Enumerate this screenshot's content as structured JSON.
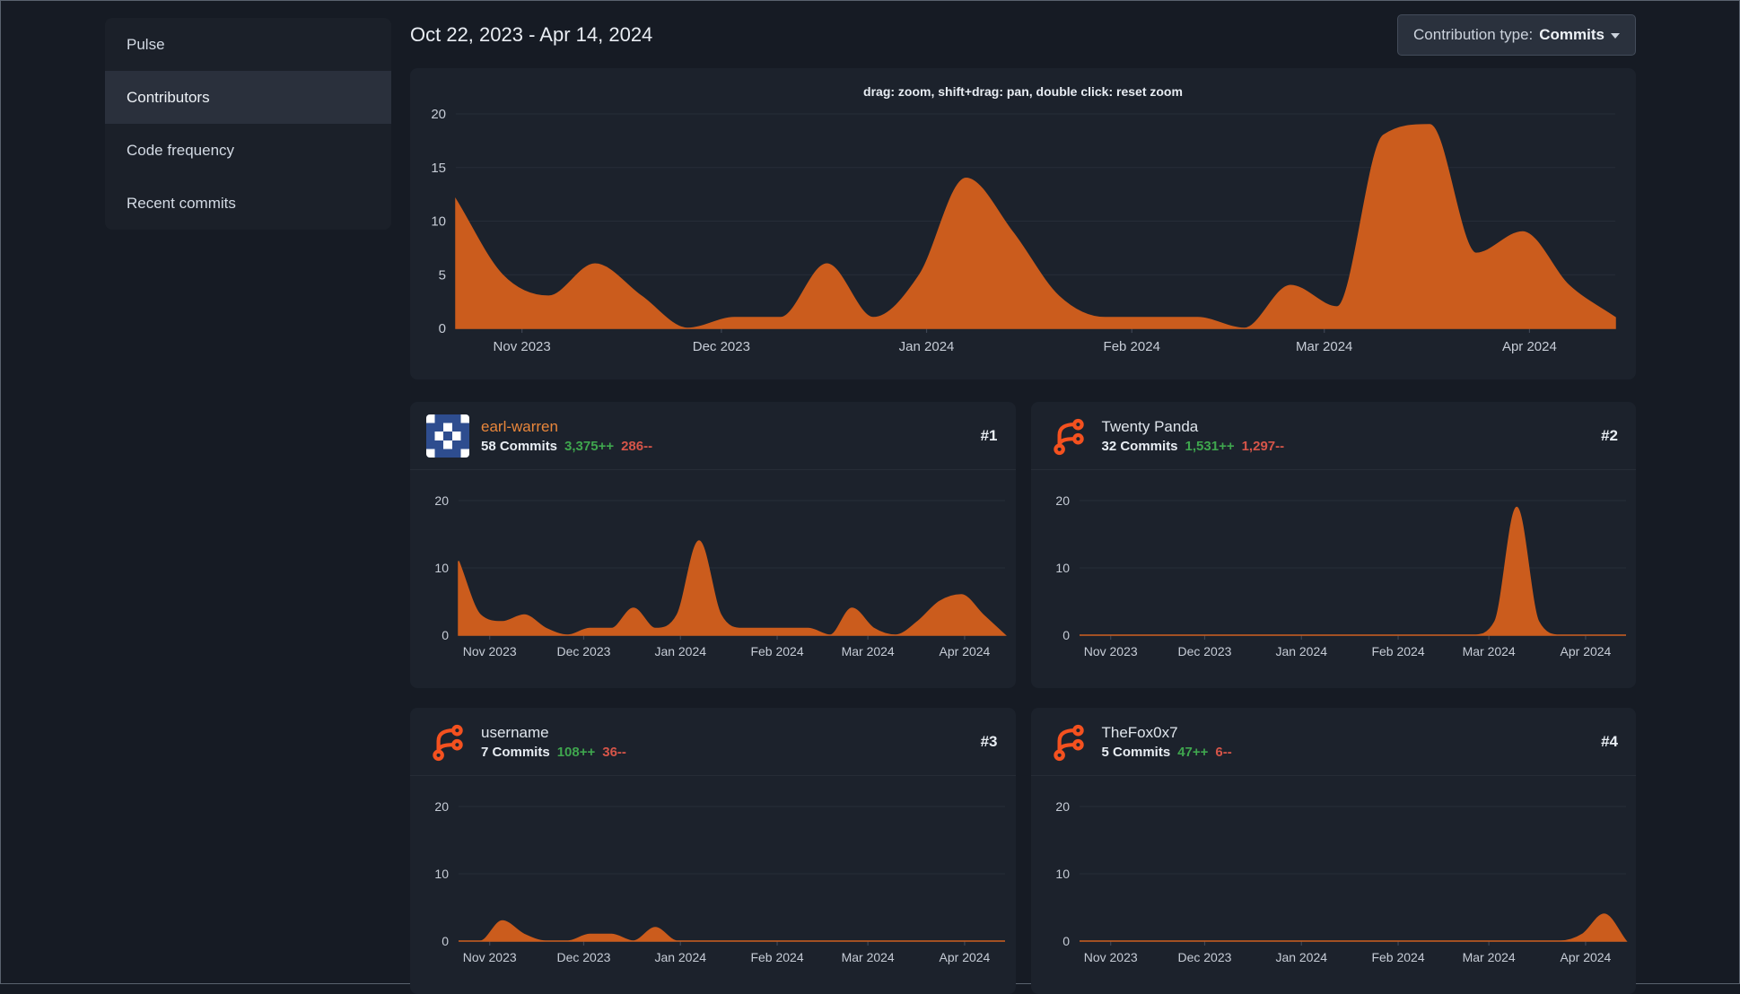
{
  "sidebar": {
    "items": [
      {
        "label": "Pulse",
        "active": false
      },
      {
        "label": "Contributors",
        "active": true
      },
      {
        "label": "Code frequency",
        "active": false
      },
      {
        "label": "Recent commits",
        "active": false
      }
    ]
  },
  "header": {
    "date_range": "Oct 22, 2023 - Apr 14, 2024",
    "contribution_type_label": "Contribution type:",
    "contribution_type_value": "Commits"
  },
  "main_chart": {
    "hint": "drag: zoom, shift+drag: pan, double click: reset zoom"
  },
  "contributors": [
    {
      "rank": "#1",
      "name": "earl-warren",
      "name_color": "#e8863b",
      "commits_text": "58 Commits",
      "additions": "3,375++",
      "deletions": "286--",
      "avatar": "identicon"
    },
    {
      "rank": "#2",
      "name": "Twenty Panda",
      "commits_text": "32 Commits",
      "additions": "1,531++",
      "deletions": "1,297--",
      "avatar": "forgejo-logo"
    },
    {
      "rank": "#3",
      "name": "username",
      "commits_text": "7 Commits",
      "additions": "108++",
      "deletions": "36--",
      "avatar": "forgejo-logo"
    },
    {
      "rank": "#4",
      "name": "TheFox0x7",
      "commits_text": "5 Commits",
      "additions": "47++",
      "deletions": "6--",
      "avatar": "forgejo-logo"
    }
  ],
  "colors": {
    "chart_orange": "#cb5c1d",
    "link_orange": "#e8863b",
    "additions_green": "#3fa64e",
    "deletions_red": "#d65549",
    "logo_orange": "#f4511f",
    "page_bg": "#161b24",
    "card_bg": "#1c222c"
  },
  "chart_data": [
    {
      "id": "overall-commits",
      "type": "area",
      "x_ticks": [
        "Nov 2023",
        "Dec 2023",
        "Jan 2024",
        "Feb 2024",
        "Mar 2024",
        "Apr 2024"
      ],
      "y_ticks": [
        0,
        5,
        10,
        15,
        20
      ],
      "ylim": [
        0,
        20
      ],
      "color": "#cb5c1d",
      "series": [
        {
          "name": "commits-per-week",
          "values": [
            12,
            5,
            3,
            6,
            3,
            0,
            1,
            1,
            6,
            1,
            5,
            14,
            9,
            3,
            1,
            1,
            1,
            0,
            4,
            2,
            18,
            19,
            7,
            9,
            4,
            1
          ]
        }
      ]
    },
    {
      "id": "earl-warren",
      "type": "area",
      "x_ticks": [
        "Nov 2023",
        "Dec 2023",
        "Jan 2024",
        "Feb 2024",
        "Mar 2024",
        "Apr 2024"
      ],
      "y_ticks": [
        0,
        10,
        20
      ],
      "ylim": [
        0,
        20
      ],
      "color": "#cb5c1d",
      "series": [
        {
          "name": "commits-per-week",
          "values": [
            11,
            3,
            2,
            3,
            1,
            0,
            1,
            1,
            4,
            1,
            3,
            14,
            3,
            1,
            1,
            1,
            1,
            0,
            4,
            1,
            0,
            2,
            5,
            6,
            3,
            0
          ]
        }
      ]
    },
    {
      "id": "twenty-panda",
      "type": "area",
      "x_ticks": [
        "Nov 2023",
        "Dec 2023",
        "Jan 2024",
        "Feb 2024",
        "Mar 2024",
        "Apr 2024"
      ],
      "y_ticks": [
        0,
        10,
        20
      ],
      "ylim": [
        0,
        20
      ],
      "color": "#cb5c1d",
      "series": [
        {
          "name": "commits-per-week",
          "values": [
            0,
            0,
            0,
            0,
            0,
            0,
            0,
            0,
            0,
            0,
            0,
            0,
            0,
            0,
            0,
            0,
            0,
            0,
            0,
            2,
            19,
            2,
            0,
            0,
            0,
            0
          ]
        }
      ]
    },
    {
      "id": "username",
      "type": "area",
      "x_ticks": [
        "Nov 2023",
        "Dec 2023",
        "Jan 2024",
        "Feb 2024",
        "Mar 2024",
        "Apr 2024"
      ],
      "y_ticks": [
        0,
        10,
        20
      ],
      "ylim": [
        0,
        20
      ],
      "color": "#cb5c1d",
      "series": [
        {
          "name": "commits-per-week",
          "values": [
            0,
            0,
            3,
            1,
            0,
            0,
            1,
            1,
            0,
            2,
            0,
            0,
            0,
            0,
            0,
            0,
            0,
            0,
            0,
            0,
            0,
            0,
            0,
            0,
            0,
            0
          ]
        }
      ]
    },
    {
      "id": "thefox0x7",
      "type": "area",
      "x_ticks": [
        "Nov 2023",
        "Dec 2023",
        "Jan 2024",
        "Feb 2024",
        "Mar 2024",
        "Apr 2024"
      ],
      "y_ticks": [
        0,
        10,
        20
      ],
      "ylim": [
        0,
        20
      ],
      "color": "#cb5c1d",
      "series": [
        {
          "name": "commits-per-week",
          "values": [
            0,
            0,
            0,
            0,
            0,
            0,
            0,
            0,
            0,
            0,
            0,
            0,
            0,
            0,
            0,
            0,
            0,
            0,
            0,
            0,
            0,
            0,
            0,
            1,
            4,
            0
          ]
        }
      ]
    }
  ]
}
